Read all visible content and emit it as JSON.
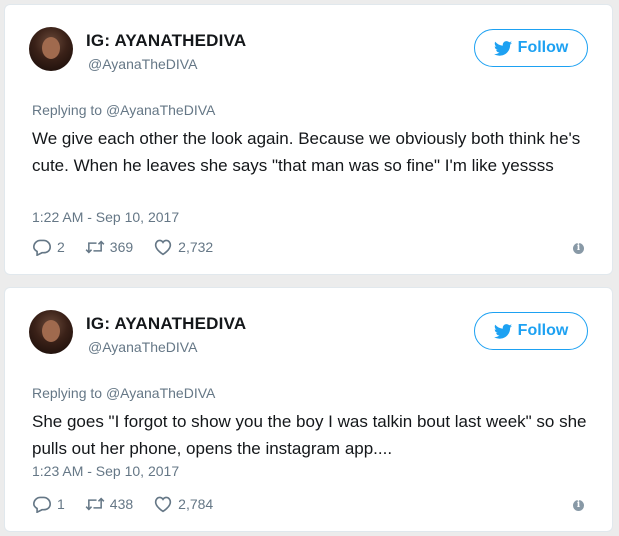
{
  "tweets": [
    {
      "display_name": "IG: AYANATHEDIVA",
      "handle": "@AyanaTheDIVA",
      "follow_label": "Follow",
      "reply_prefix": "Replying to",
      "reply_to": "@AyanaTheDIVA",
      "text": "We give each other the look again. Because we obviously both think he's cute. When he leaves she says \"that man was so fine\" I'm like yessss",
      "timestamp": "1:22 AM - Sep 10, 2017",
      "replies": "2",
      "retweets": "369",
      "likes": "2,732",
      "info_icon": "info-icon"
    },
    {
      "display_name": "IG: AYANATHEDIVA",
      "handle": "@AyanaTheDIVA",
      "follow_label": "Follow",
      "reply_prefix": "Replying to",
      "reply_to": "@AyanaTheDIVA",
      "text": "She goes \"I forgot to show you the boy I was talkin bout last week\" so she pulls out her phone, opens the instagram app....",
      "timestamp": "1:23 AM - Sep 10, 2017",
      "replies": "1",
      "retweets": "438",
      "likes": "2,784",
      "info_icon": "info-icon"
    }
  ],
  "colors": {
    "accent": "#1da1f2",
    "muted": "#657786",
    "text": "#14171a",
    "card_border": "#e1e8ed",
    "page_bg": "#ececec"
  }
}
